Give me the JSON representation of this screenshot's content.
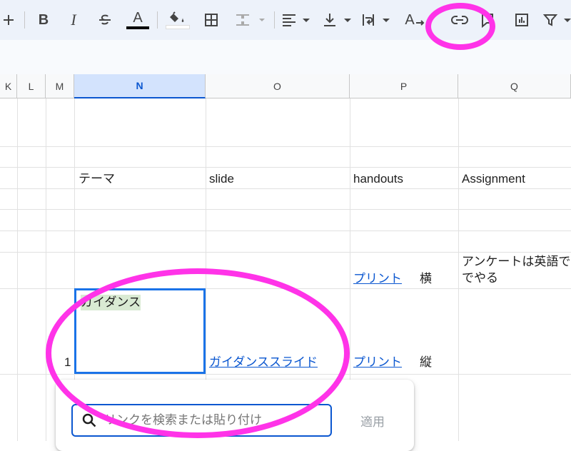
{
  "toolbar": {
    "items": [
      {
        "name": "add-icon"
      },
      {
        "name": "bold-icon",
        "label": "B"
      },
      {
        "name": "italic-icon",
        "label": "I"
      },
      {
        "name": "strikethrough-icon"
      },
      {
        "name": "text-color-icon",
        "label": "A"
      },
      {
        "name": "fill-color-icon"
      },
      {
        "name": "borders-icon"
      },
      {
        "name": "merge-cells-icon"
      },
      {
        "name": "align-left-icon"
      },
      {
        "name": "valign-bottom-icon"
      },
      {
        "name": "text-wrap-icon"
      },
      {
        "name": "text-rotation-icon",
        "label": "A"
      },
      {
        "name": "insert-link-icon"
      },
      {
        "name": "insert-comment-icon"
      },
      {
        "name": "insert-chart-icon"
      },
      {
        "name": "filter-icon"
      }
    ],
    "text_color": "#000000",
    "fill_color": "#ffffff"
  },
  "columns": [
    "K",
    "L",
    "M",
    "N",
    "O",
    "P",
    "Q"
  ],
  "selected_column": "N",
  "cells": {
    "row_header": {
      "N": "テーマ",
      "O": "slide",
      "P": "handouts",
      "Q": "Assignment"
    },
    "row_a": {
      "P_link": "プリント",
      "P_extra": "横",
      "Q_line1": "アンケートは英語で",
      "Q_line2": "でやる"
    },
    "row_b": {
      "M": "1",
      "N": "ガイダンス",
      "O_link": "ガイダンススライド",
      "P_link": "プリント",
      "P_extra": "縦"
    }
  },
  "link_popup": {
    "placeholder": "リンクを検索または貼り付け",
    "apply_label": "適用"
  },
  "annotation_color": "#ff33e8",
  "accent_color": "#1a73e8"
}
